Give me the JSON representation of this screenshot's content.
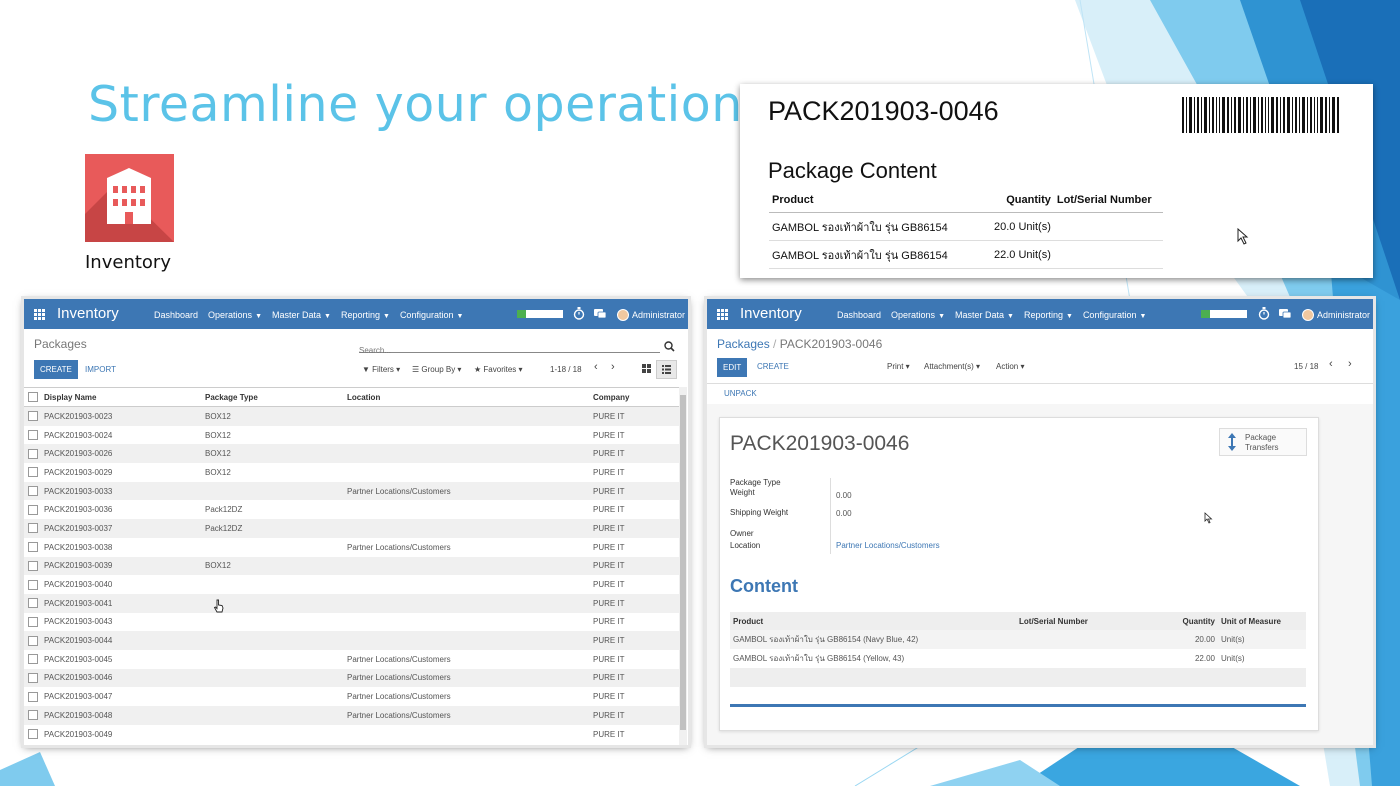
{
  "slide": {
    "title": "Streamline your operation",
    "app_label": "Inventory",
    "accent": "#5bc3e8"
  },
  "report": {
    "package_name": "PACK201903-0046",
    "section_title": "Package Content",
    "columns": [
      "Product",
      "Quantity",
      "Lot/Serial Number"
    ],
    "rows": [
      {
        "product": "GAMBOL รองเท้าผ้าใบ รุ่น GB86154",
        "quantity": "20.0 Unit(s)",
        "lot": ""
      },
      {
        "product": "GAMBOL รองเท้าผ้าใบ รุ่น GB86154",
        "quantity": "22.0 Unit(s)",
        "lot": ""
      }
    ]
  },
  "nav": {
    "app_name": "Inventory",
    "menu": [
      "Dashboard",
      "Operations",
      "Master Data",
      "Reporting",
      "Configuration"
    ],
    "user": "Administrator",
    "progress": 0.2,
    "color": "#3d77b4",
    "icons": [
      "apps-grid-icon",
      "timer-icon",
      "chat-icon",
      "user-avatar"
    ]
  },
  "list_view": {
    "breadcrumb": "Packages",
    "search_placeholder": "Search...",
    "create_label": "CREATE",
    "import_label": "IMPORT",
    "filters_label": "Filters",
    "groupby_label": "Group By",
    "favorites_label": "Favorites",
    "pager": "1-18 / 18",
    "columns": [
      "Display Name",
      "Package Type",
      "Location",
      "Company"
    ],
    "rows": [
      {
        "name": "PACK201903-0023",
        "type": "BOX12",
        "location": "",
        "company": "PURE IT"
      },
      {
        "name": "PACK201903-0024",
        "type": "BOX12",
        "location": "",
        "company": "PURE IT"
      },
      {
        "name": "PACK201903-0026",
        "type": "BOX12",
        "location": "",
        "company": "PURE IT"
      },
      {
        "name": "PACK201903-0029",
        "type": "BOX12",
        "location": "",
        "company": "PURE IT"
      },
      {
        "name": "PACK201903-0033",
        "type": "",
        "location": "Partner Locations/Customers",
        "company": "PURE IT"
      },
      {
        "name": "PACK201903-0036",
        "type": "Pack12DZ",
        "location": "",
        "company": "PURE IT"
      },
      {
        "name": "PACK201903-0037",
        "type": "Pack12DZ",
        "location": "",
        "company": "PURE IT"
      },
      {
        "name": "PACK201903-0038",
        "type": "",
        "location": "Partner Locations/Customers",
        "company": "PURE IT"
      },
      {
        "name": "PACK201903-0039",
        "type": "BOX12",
        "location": "",
        "company": "PURE IT"
      },
      {
        "name": "PACK201903-0040",
        "type": "",
        "location": "",
        "company": "PURE IT"
      },
      {
        "name": "PACK201903-0041",
        "type": "",
        "location": "",
        "company": "PURE IT"
      },
      {
        "name": "PACK201903-0043",
        "type": "",
        "location": "",
        "company": "PURE IT"
      },
      {
        "name": "PACK201903-0044",
        "type": "",
        "location": "",
        "company": "PURE IT"
      },
      {
        "name": "PACK201903-0045",
        "type": "",
        "location": "Partner Locations/Customers",
        "company": "PURE IT"
      },
      {
        "name": "PACK201903-0046",
        "type": "",
        "location": "Partner Locations/Customers",
        "company": "PURE IT"
      },
      {
        "name": "PACK201903-0047",
        "type": "",
        "location": "Partner Locations/Customers",
        "company": "PURE IT"
      },
      {
        "name": "PACK201903-0048",
        "type": "",
        "location": "Partner Locations/Customers",
        "company": "PURE IT"
      },
      {
        "name": "PACK201903-0049",
        "type": "",
        "location": "",
        "company": "PURE IT"
      }
    ]
  },
  "form_view": {
    "breadcrumb_parent": "Packages",
    "breadcrumb_sep": "/",
    "breadcrumb_current": "PACK201903-0046",
    "edit_label": "EDIT",
    "create_label": "CREATE",
    "print_label": "Print",
    "attachments_label": "Attachment(s)",
    "action_label": "Action",
    "pager": "15 / 18",
    "unpack_label": "UNPACK",
    "package_name": "PACK201903-0046",
    "smart_button_line1": "Package",
    "smart_button_line2": "Transfers",
    "fields": {
      "package_type_label": "Package Type",
      "weight_label": "Weight",
      "weight_value": "0.00",
      "shipping_weight_label": "Shipping Weight",
      "shipping_weight_value": "0.00",
      "owner_label": "Owner",
      "location_label": "Location",
      "location_value": "Partner Locations/Customers"
    },
    "content_title": "Content",
    "content_columns": [
      "Product",
      "Lot/Serial Number",
      "Quantity",
      "Unit of Measure"
    ],
    "content_rows": [
      {
        "product": "GAMBOL รองเท้าผ้าใบ รุ่น GB86154 (Navy Blue, 42)",
        "lot": "",
        "quantity": "20.00",
        "uom": "Unit(s)"
      },
      {
        "product": "GAMBOL รองเท้าผ้าใบ รุ่น GB86154 (Yellow, 43)",
        "lot": "",
        "quantity": "22.00",
        "uom": "Unit(s)"
      }
    ]
  }
}
